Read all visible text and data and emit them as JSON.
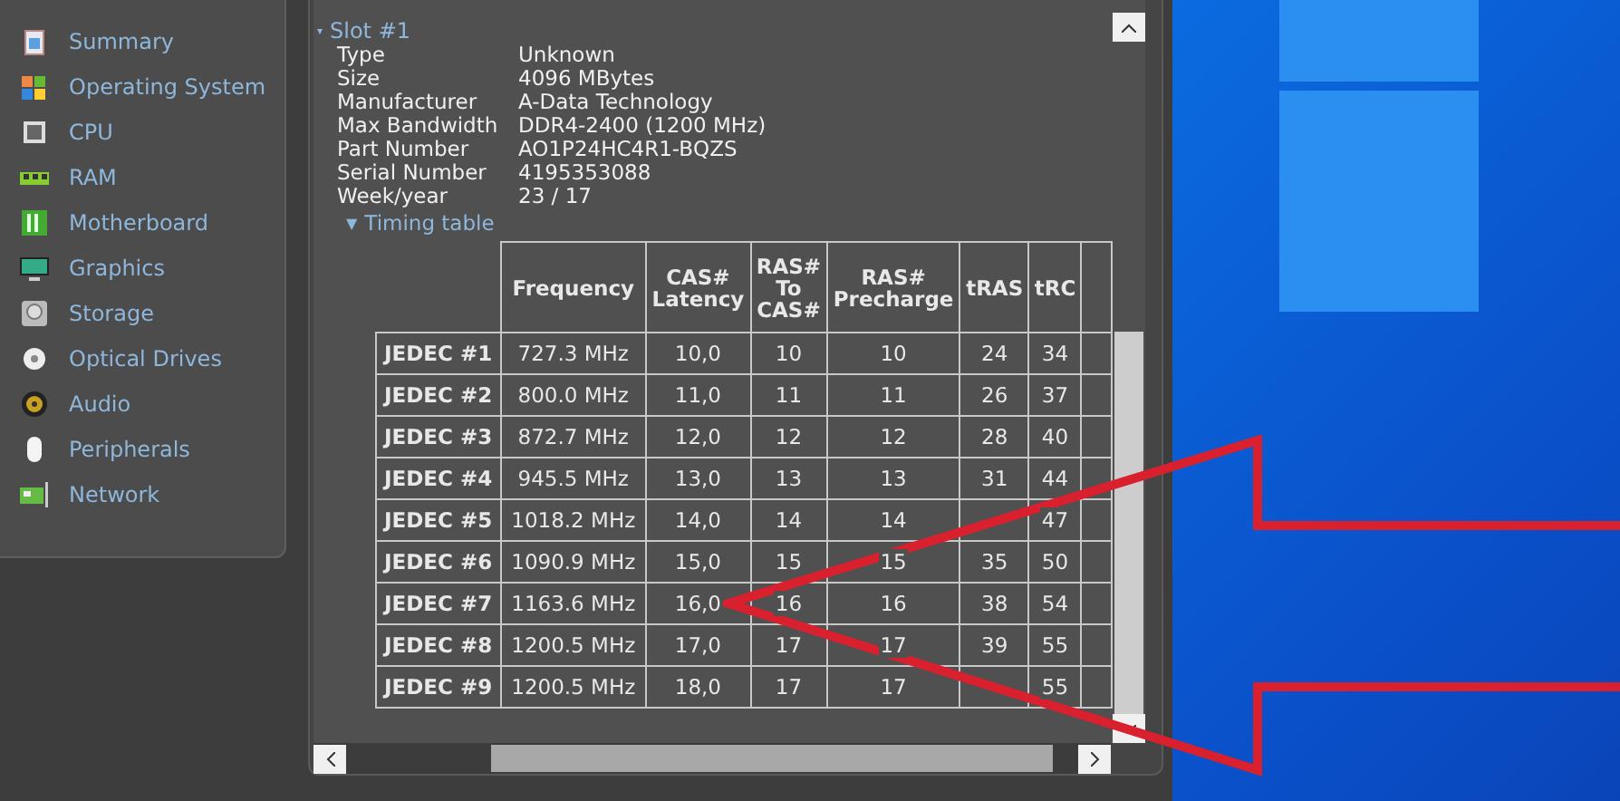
{
  "sidebar": {
    "items": [
      {
        "label": "Summary"
      },
      {
        "label": "Operating System"
      },
      {
        "label": "CPU"
      },
      {
        "label": "RAM"
      },
      {
        "label": "Motherboard"
      },
      {
        "label": "Graphics"
      },
      {
        "label": "Storage"
      },
      {
        "label": "Optical Drives"
      },
      {
        "label": "Audio"
      },
      {
        "label": "Peripherals"
      },
      {
        "label": "Network"
      }
    ]
  },
  "slot": {
    "title": "Slot #1",
    "toggle": "▾",
    "expanded": true,
    "properties": [
      {
        "name": "Type",
        "value": "Unknown"
      },
      {
        "name": "Size",
        "value": "4096 MBytes"
      },
      {
        "name": "Manufacturer",
        "value": "A-Data Technology"
      },
      {
        "name": "Max Bandwidth",
        "value": "DDR4-2400 (1200 MHz)"
      },
      {
        "name": "Part Number",
        "value": "AO1P24HC4R1-BQZS"
      },
      {
        "name": "Serial Number",
        "value": "4195353088"
      },
      {
        "name": "Week/year",
        "value": "23 / 17"
      }
    ],
    "timing_table": {
      "title": "Timing table",
      "toggle": "▼",
      "expanded": true,
      "columns": [
        "Frequency",
        "CAS# Latency",
        "RAS# To CAS#",
        "RAS# Precharge",
        "tRAS",
        "tRC"
      ],
      "rows": [
        {
          "name": "JEDEC #1",
          "cells": [
            "727.3 MHz",
            "10,0",
            "10",
            "10",
            "24",
            "34"
          ]
        },
        {
          "name": "JEDEC #2",
          "cells": [
            "800.0 MHz",
            "11,0",
            "11",
            "11",
            "26",
            "37"
          ]
        },
        {
          "name": "JEDEC #3",
          "cells": [
            "872.7 MHz",
            "12,0",
            "12",
            "12",
            "28",
            "40"
          ]
        },
        {
          "name": "JEDEC #4",
          "cells": [
            "945.5 MHz",
            "13,0",
            "13",
            "13",
            "31",
            "44"
          ]
        },
        {
          "name": "JEDEC #5",
          "cells": [
            "1018.2 MHz",
            "14,0",
            "14",
            "14",
            null,
            "47"
          ]
        },
        {
          "name": "JEDEC #6",
          "cells": [
            "1090.9 MHz",
            "15,0",
            "15",
            "15",
            "35",
            "50"
          ]
        },
        {
          "name": "JEDEC #7",
          "cells": [
            "1163.6 MHz",
            "16,0",
            "16",
            "16",
            "38",
            "54"
          ]
        },
        {
          "name": "JEDEC #8",
          "cells": [
            "1200.5 MHz",
            "17,0",
            "17",
            "17",
            "39",
            "55"
          ]
        },
        {
          "name": "JEDEC #9",
          "cells": [
            "1200.5 MHz",
            "18,0",
            "17",
            "17",
            null,
            "55"
          ]
        }
      ]
    }
  }
}
